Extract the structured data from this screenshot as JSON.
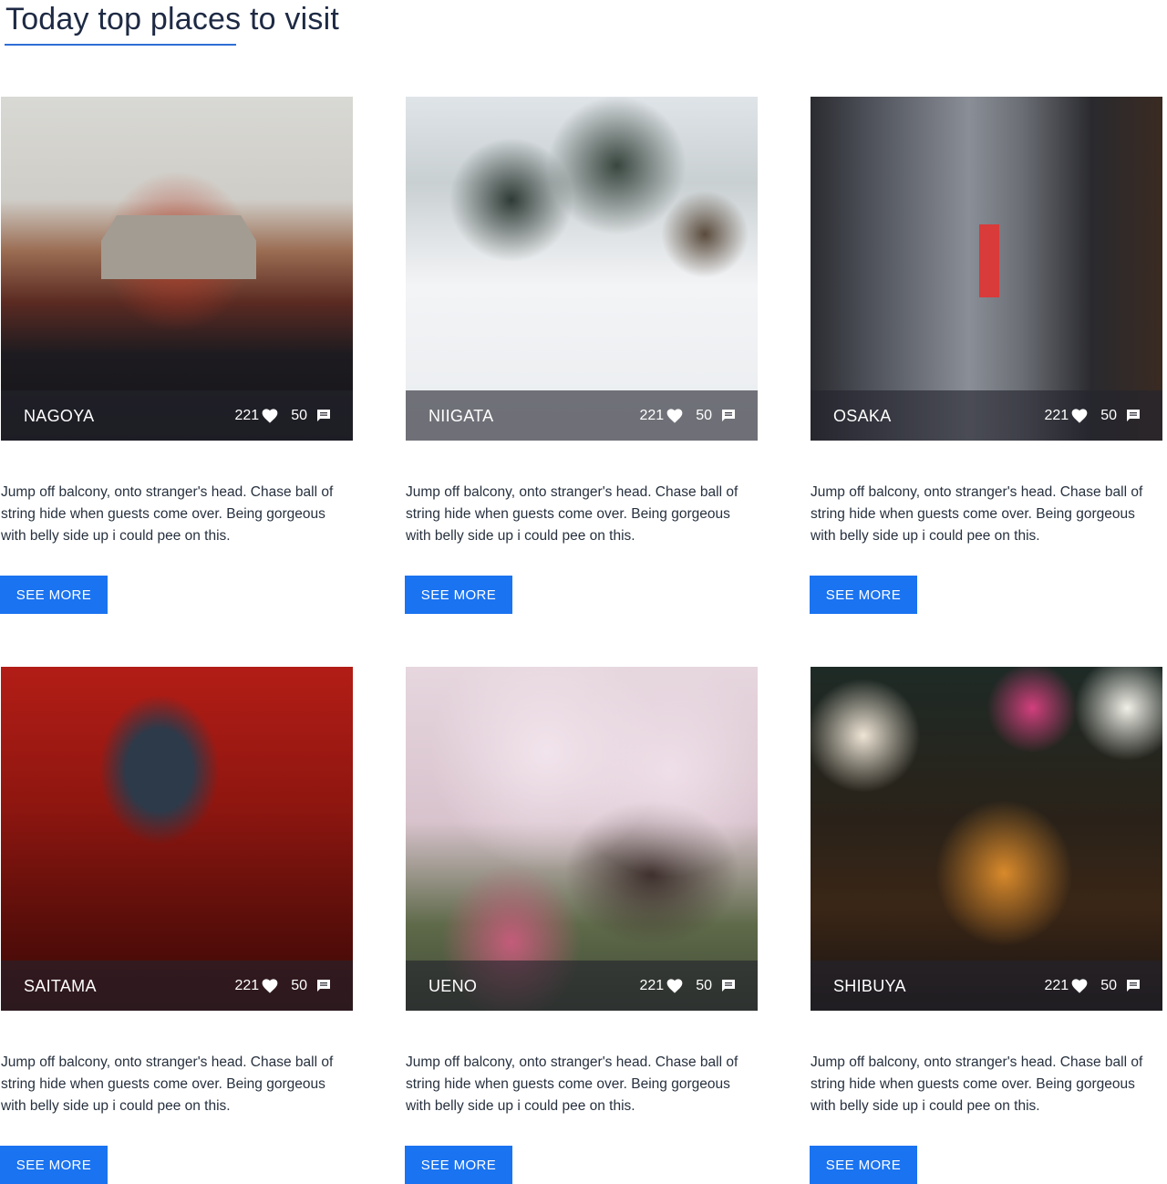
{
  "header": {
    "title": "Today top places to visit"
  },
  "cards": [
    {
      "name": "NAGOYA",
      "likes": "221",
      "comments": "50",
      "description": "Jump off balcony, onto stranger's head. Chase ball of string hide when guests come over. Being gorgeous with belly side up i could pee on this.",
      "button_label": "SEE MORE"
    },
    {
      "name": "NIIGATA",
      "likes": "221",
      "comments": "50",
      "description": "Jump off balcony, onto stranger's head. Chase ball of string hide when guests come over. Being gorgeous with belly side up i could pee on this.",
      "button_label": "SEE MORE"
    },
    {
      "name": "OSAKA",
      "likes": "221",
      "comments": "50",
      "description": "Jump off balcony, onto stranger's head. Chase ball of string hide when guests come over. Being gorgeous with belly side up i could pee on this.",
      "button_label": "SEE MORE"
    },
    {
      "name": "SAITAMA",
      "likes": "221",
      "comments": "50",
      "description": "Jump off balcony, onto stranger's head. Chase ball of string hide when guests come over. Being gorgeous with belly side up i could pee on this.",
      "button_label": "SEE MORE"
    },
    {
      "name": "UENO",
      "likes": "221",
      "comments": "50",
      "description": "Jump off balcony, onto stranger's head. Chase ball of string hide when guests come over. Being gorgeous with belly side up i could pee on this.",
      "button_label": "SEE MORE"
    },
    {
      "name": "SHIBUYA",
      "likes": "221",
      "comments": "50",
      "description": "Jump off balcony, onto stranger's head. Chase ball of string hide when guests come over. Being gorgeous with belly side up i could pee on this.",
      "button_label": "SEE MORE"
    }
  ],
  "icons": {
    "likes": "heart-icon",
    "comments": "comment-icon"
  },
  "colors": {
    "accent": "#1a73f0",
    "title": "#1e2a44",
    "underline": "#2f6fd6",
    "overlay": "#23232d"
  }
}
